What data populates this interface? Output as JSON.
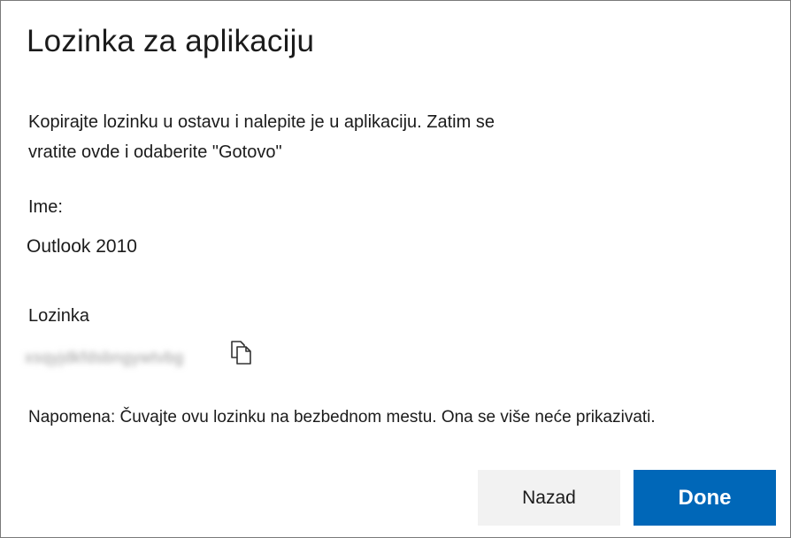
{
  "dialog": {
    "title": "Lozinka za aplikaciju",
    "instructions_line1": "Kopirajte lozinku u ostavu i nalepite je u aplikaciju. Zatim se",
    "instructions_line2": "vratite ovde i odaberite \"Gotovo\"",
    "name_label": "Ime:",
    "name_value": "Outlook 2010",
    "password_label": "Lozinka",
    "password_value": "xsqyjdkfdsbngywtvbg",
    "copy_icon": "copy-icon",
    "note": "Napomena: Čuvajte ovu lozinku na bezbednom mestu. Ona se više neće prikazivati."
  },
  "buttons": {
    "back_label": "Nazad",
    "done_label": "Done"
  },
  "colors": {
    "primary": "#0067b8",
    "secondary_button": "#f2f2f2",
    "text": "#1b1b1b"
  }
}
